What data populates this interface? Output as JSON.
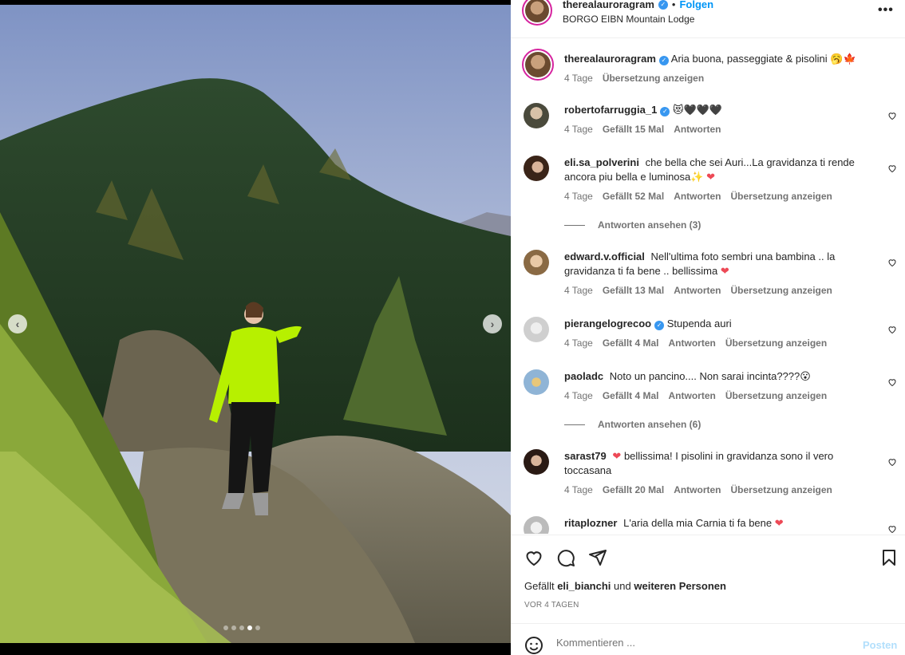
{
  "post": {
    "username": "therealauroragram",
    "follow_label": "Folgen",
    "bullet": "•",
    "location": "BORGO EIBN Mountain Lodge",
    "more_label": "•••",
    "verified_mark": "✓"
  },
  "caption": {
    "username": "therealauroragram",
    "text": "Aria buona, passeggiate & pisolini 🥱🍁",
    "age": "4 Tage",
    "translate": "Übersetzung anzeigen"
  },
  "comments": [
    {
      "username": "robertofarruggia_1",
      "verified": true,
      "text": "😻🖤🖤🖤",
      "age": "4 Tage",
      "likes": "Gefällt 15 Mal",
      "reply": "Antworten",
      "translate": ""
    },
    {
      "username": "eli.sa_polverini",
      "verified": false,
      "text": "che bella che sei Auri...La gravidanza ti rende ancora piu bella e luminosa✨",
      "heart": "❤",
      "age": "4 Tage",
      "likes": "Gefällt 52 Mal",
      "reply": "Antworten",
      "translate": "Übersetzung anzeigen",
      "view_replies": "Antworten ansehen (3)"
    },
    {
      "username": "edward.v.official",
      "verified": false,
      "text": "Nell'ultima foto sembri una bambina .. la gravidanza ti fa bene .. bellissima",
      "heart": "❤",
      "age": "4 Tage",
      "likes": "Gefällt 13 Mal",
      "reply": "Antworten",
      "translate": "Übersetzung anzeigen"
    },
    {
      "username": "pierangelogrecoo",
      "verified": true,
      "text": "Stupenda auri",
      "age": "4 Tage",
      "likes": "Gefällt 4 Mal",
      "reply": "Antworten",
      "translate": "Übersetzung anzeigen"
    },
    {
      "username": "paoladc",
      "verified": false,
      "text": "Noto un pancino.... Non sarai incinta????😮",
      "age": "4 Tage",
      "likes": "Gefällt 4 Mal",
      "reply": "Antworten",
      "translate": "Übersetzung anzeigen",
      "view_replies": "Antworten ansehen (6)"
    },
    {
      "username": "sarast79",
      "verified": false,
      "pre_heart": "❤",
      "text": "bellissima! I pisolini in gravidanza sono il vero toccasana",
      "age": "4 Tage",
      "likes": "Gefällt 20 Mal",
      "reply": "Antworten",
      "translate": "Übersetzung anzeigen"
    },
    {
      "username": "ritaplozner",
      "verified": false,
      "text": "L'aria della mia Carnia ti fa bene",
      "heart": "❤"
    }
  ],
  "actions": {
    "liked_by_prefix": "Gefällt",
    "liked_by_user": "eli_bianchi",
    "liked_by_mid": "und",
    "liked_by_others": "weiteren Personen",
    "date": "VOR 4 TAGEN"
  },
  "comment_box": {
    "placeholder": "Kommentieren ...",
    "post_label": "Posten"
  },
  "carousel": {
    "slides": 5,
    "active_index": 3
  },
  "colors": {
    "accent": "#0095f6",
    "verified": "#3897f0",
    "heart": "#ed4956",
    "sweater": "#b5f000"
  },
  "icons": [
    "like-icon",
    "comment-icon",
    "share-icon",
    "save-icon",
    "emoji-icon",
    "chevron-left-icon",
    "chevron-right-icon"
  ]
}
